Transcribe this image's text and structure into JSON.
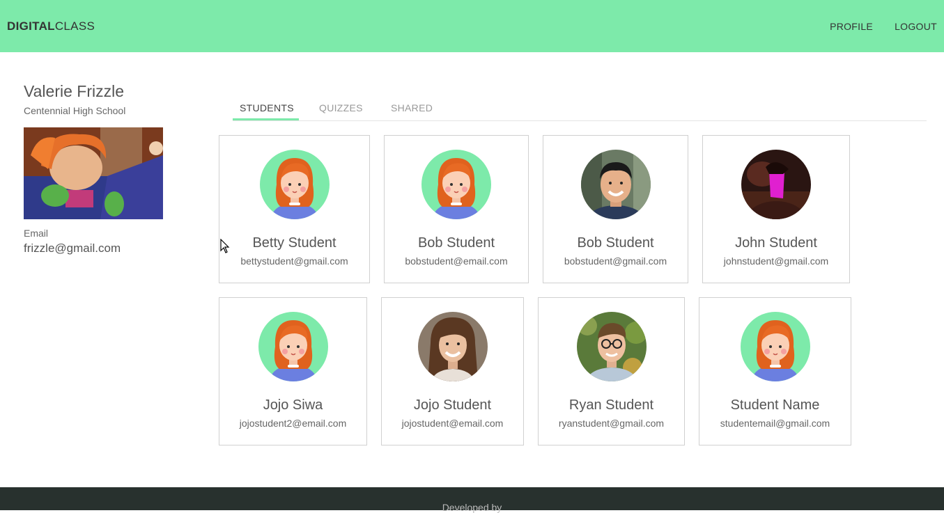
{
  "brand": {
    "bold": "DIGITAL",
    "rest": "CLASS"
  },
  "nav": {
    "profile": "PROFILE",
    "logout": "LOGOUT"
  },
  "profile": {
    "name": "Valerie Frizzle",
    "school": "Centennial High School",
    "email_label": "Email",
    "email": "frizzle@gmail.com"
  },
  "tabs": [
    "STUDENTS",
    "QUIZZES",
    "SHARED"
  ],
  "active_tab": "STUDENTS",
  "students": [
    {
      "name": "Betty Student",
      "email": "bettystudent@gmail.com",
      "avatar": "cartoon-girl"
    },
    {
      "name": "Bob Student",
      "email": "bobstudent@email.com",
      "avatar": "cartoon-girl"
    },
    {
      "name": "Bob Student",
      "email": "bobstudent@gmail.com",
      "avatar": "photo-man-smiling"
    },
    {
      "name": "John Student",
      "email": "johnstudent@gmail.com",
      "avatar": "photo-dark-portrait"
    },
    {
      "name": "Jojo Siwa",
      "email": "jojostudent2@email.com",
      "avatar": "cartoon-girl"
    },
    {
      "name": "Jojo Student",
      "email": "jojostudent@email.com",
      "avatar": "photo-woman-smiling"
    },
    {
      "name": "Ryan Student",
      "email": "ryanstudent@gmail.com",
      "avatar": "photo-man-glasses"
    },
    {
      "name": "Student Name",
      "email": "studentemail@gmail.com",
      "avatar": "cartoon-girl"
    }
  ],
  "footer": {
    "text": "Developed by"
  },
  "colors": {
    "accent": "#7deaaa",
    "footer": "#28312e"
  }
}
